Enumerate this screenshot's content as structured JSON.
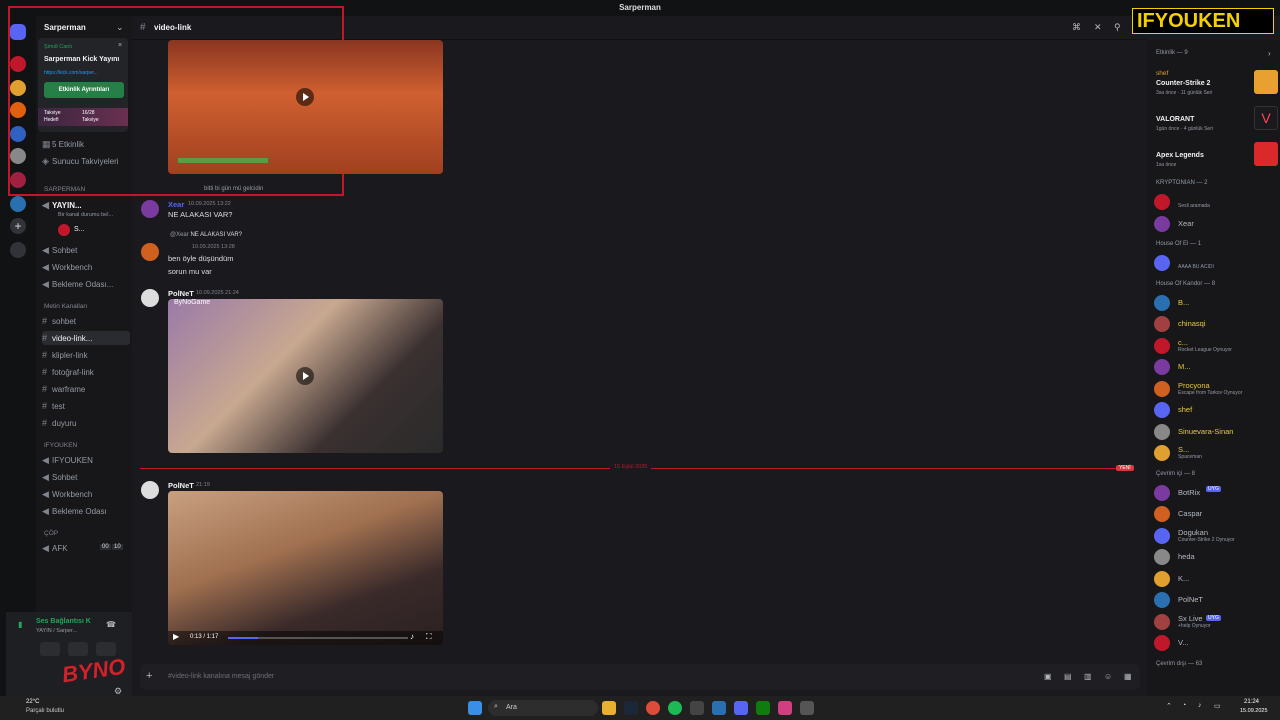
{
  "window": {
    "title": "Sarperman"
  },
  "brand": {
    "logo_text": "IFYOUKEN",
    "corner_logo_text": "BYNO"
  },
  "server": {
    "name": "Sarperman"
  },
  "live_popup": {
    "status": "Şimdi Canlı",
    "title": "Sarperman Kick Yayını",
    "link": "https://kick.com/sarper...",
    "button_label": "Etkinlik Ayrıntıları",
    "boost_label": "Takviye Hedefi",
    "boost_count": "16/28",
    "boost_unit": "Takviye"
  },
  "channel_sidebar": {
    "events": "5 Etkinlik",
    "boosts": "Sunucu Takviyeleri",
    "category_sarperman": "SARPERMAN",
    "live_channel": "YAYIN...",
    "live_subtitle": "Bir kanal durumu bel...",
    "live_user": "S...",
    "voice_channels_top": [
      "Sohbet",
      "Workbench",
      "Bekleme Odası..."
    ],
    "text_category": "Metin Kanalları",
    "text_channels": [
      "sohbet",
      "video-link...",
      "klipler-link",
      "fotoğraf-link",
      "warframe",
      "test",
      "duyuru"
    ],
    "ifyouken_category": "IFYOUKEN",
    "ifyouken_channels": [
      "IFYOUKEN",
      "Sohbet",
      "Workbench",
      "Bekleme Odası"
    ],
    "cop_category": "ÇÖP",
    "afk_channel": "AFK",
    "afk_counts": [
      "00",
      "10"
    ],
    "voice_status": "Ses Bağlantısı K",
    "voice_sub": "YAYIN / Sarper..."
  },
  "channel_header": {
    "name": "video-link"
  },
  "messages": [
    {
      "author": "Xear",
      "time": "10.09.2025 13:22",
      "text": "NE ALAKASI VAR?"
    },
    {
      "reply_author": "@Xear",
      "reply_text": "NE ALAKASI VAR?",
      "author": "",
      "time": "10.09.2025 13:28",
      "lines": [
        "ben öyle düşündüm",
        "sorun mu var"
      ]
    },
    {
      "author": "PolNeT",
      "time": "10.09.2025 21:24",
      "video_label": "ByNoGame"
    },
    {
      "author": "PolNeT",
      "time": "21:19",
      "video_time": "0:13 / 1:17"
    }
  ],
  "top_message_fragment": "bitti bi gün mü gelcidin",
  "date_divider": {
    "date": "15 Eylül 2025",
    "badge": "YENİ"
  },
  "composer": {
    "placeholder": "#video-link kanalına mesaj gönder"
  },
  "members": {
    "activity_header": "Etkinlik — 9",
    "activities": [
      {
        "name": "shef",
        "game": "Counter-Strike 2",
        "detail": "3sa önce · 11 günlük Seri"
      },
      {
        "name": "",
        "game": "VALORANT",
        "detail": "1gün önce · 4 günlük Seri"
      },
      {
        "name": "",
        "game": "Apex Legends",
        "detail": "1sa önce"
      }
    ],
    "groups": [
      {
        "title": "KRYPTONIAN — 2",
        "items": [
          {
            "name": "",
            "sub": "Sesli aramada"
          },
          {
            "name": "Xear",
            "sub": ""
          }
        ]
      },
      {
        "title": "House Of El — 1",
        "items": [
          {
            "name": "",
            "sub": "AAAA BU ACIDI"
          }
        ]
      },
      {
        "title": "House Of Kandor — 8",
        "items": [
          {
            "name": "B...",
            "sub": ""
          },
          {
            "name": "chinasqi",
            "sub": ""
          },
          {
            "name": "c...",
            "sub": "Rocket League Oynuyor"
          },
          {
            "name": "M...",
            "sub": ""
          },
          {
            "name": "Procyona",
            "sub": "Escape from Tarkov Oynuyor"
          },
          {
            "name": "shef",
            "sub": ""
          },
          {
            "name": "Sinuevara-Sinan",
            "sub": ""
          },
          {
            "name": "S...",
            "sub": "Spaceman"
          }
        ]
      },
      {
        "title": "Çevrim içi — 8",
        "items": [
          {
            "name": "BotRix",
            "sub": "",
            "badge": "UYG"
          },
          {
            "name": "Caspar",
            "sub": ""
          },
          {
            "name": "Dogukan",
            "sub": "Counter-Strike 2 Oynuyor"
          },
          {
            "name": "heda",
            "sub": ""
          },
          {
            "name": "K...",
            "sub": ""
          },
          {
            "name": "PolNeT",
            "sub": ""
          },
          {
            "name": "Sx Live",
            "sub": "+help Oynuyor",
            "badge": "UYG"
          },
          {
            "name": "V...",
            "sub": ""
          }
        ]
      },
      {
        "title": "Çevrim dışı — 63",
        "items": []
      }
    ]
  },
  "taskbar": {
    "weather_temp": "22°C",
    "weather_text": "Parçalı bulutlu",
    "search": "Ara",
    "time": "21:24",
    "date": "15.09.2025"
  },
  "colors": {
    "accent_red": "#c0182a",
    "green": "#248046",
    "blurple": "#5865f2"
  }
}
